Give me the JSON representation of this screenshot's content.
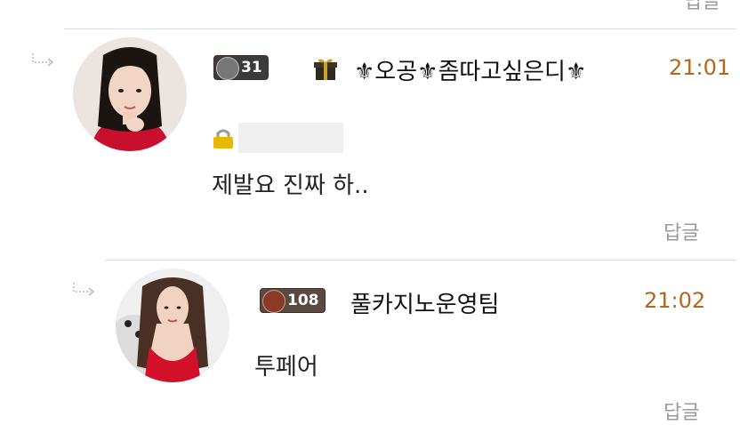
{
  "comments": [
    {
      "nickname": "⚜오공⚜좀따고싶은디⚜",
      "time": "21:01",
      "level": "31",
      "content": "제발요 진짜 하..",
      "reply_label": "답글"
    },
    {
      "nickname": "풀카지노운영팀",
      "time": "21:02",
      "level": "108",
      "content": "투페어",
      "reply_label": "답글"
    }
  ],
  "top_reply_label": "답글",
  "colors": {
    "time": "#b5651d",
    "reply": "#9a9a9a",
    "divider": "#dcdcdc"
  },
  "icons": {
    "indent_arrow": "reply-arrow-icon",
    "gift": "gift-icon",
    "lock": "lock-icon"
  }
}
